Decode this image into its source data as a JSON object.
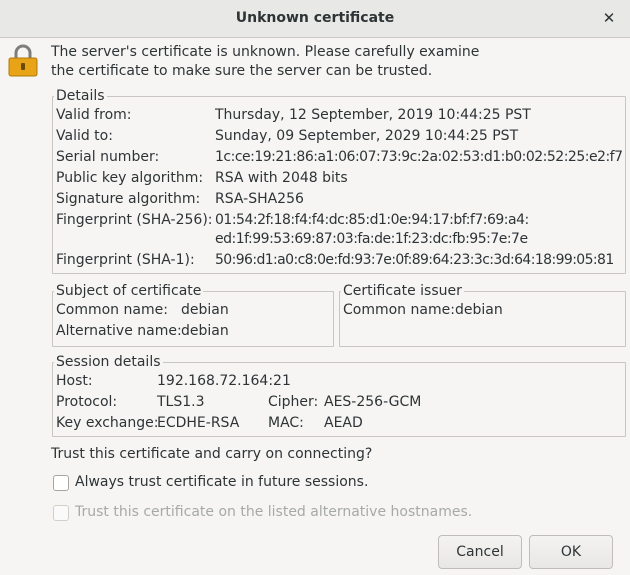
{
  "window": {
    "title": "Unknown certificate"
  },
  "message": {
    "line1": "The server's certificate is unknown. Please carefully examine",
    "line2": "the certificate to make sure the server can be trusted."
  },
  "details": {
    "legend": "Details",
    "valid_from_label": "Valid from:",
    "valid_from": "Thursday, 12 September, 2019 10:44:25  PST",
    "valid_to_label": "Valid to:",
    "valid_to": "Sunday, 09 September, 2029 10:44:25  PST",
    "serial_label": "Serial number:",
    "serial": "1c:ce:19:21:86:a1:06:07:73:9c:2a:02:53:d1:b0:02:52:25:e2:f7",
    "pubkey_label": "Public key algorithm:",
    "pubkey": "RSA with 2048 bits",
    "sigalg_label": "Signature algorithm:",
    "sigalg": "RSA-SHA256",
    "sha256_label": "Fingerprint (SHA-256):",
    "sha256_line1": "01:54:2f:18:f4:f4:dc:85:d1:0e:94:17:bf:f7:69:a4:",
    "sha256_line2": "ed:1f:99:53:69:87:03:fa:de:1f:23:dc:fb:95:7e:7e",
    "sha1_label": "Fingerprint (SHA-1):",
    "sha1": "50:96:d1:a0:c8:0e:fd:93:7e:0f:89:64:23:3c:3d:64:18:99:05:81"
  },
  "subject": {
    "legend": "Subject of certificate",
    "common_name_label": "Common name:",
    "common_name": "debian",
    "alt_name_label": "Alternative name:",
    "alt_name": "debian"
  },
  "issuer": {
    "legend": "Certificate issuer",
    "common_name_label": "Common name:",
    "common_name": "debian"
  },
  "session": {
    "legend": "Session details",
    "host_label": "Host:",
    "host": "192.168.72.164:21",
    "protocol_label": "Protocol:",
    "protocol": "TLS1.3",
    "cipher_label": "Cipher:",
    "cipher": "AES-256-GCM",
    "kex_label": "Key exchange:",
    "kex": "ECDHE-RSA",
    "mac_label": "MAC:",
    "mac": "AEAD"
  },
  "question": "Trust this certificate and carry on connecting?",
  "options": {
    "always_trust": "Always trust certificate in future sessions.",
    "trust_alt_hosts": "Trust this certificate on the listed alternative hostnames."
  },
  "buttons": {
    "cancel": "Cancel",
    "ok": "OK"
  },
  "icons": {
    "close": "close-icon",
    "lock": "lock-icon"
  },
  "colors": {
    "lock_body": "#e8a317",
    "lock_shackle": "#7d7d7d"
  }
}
